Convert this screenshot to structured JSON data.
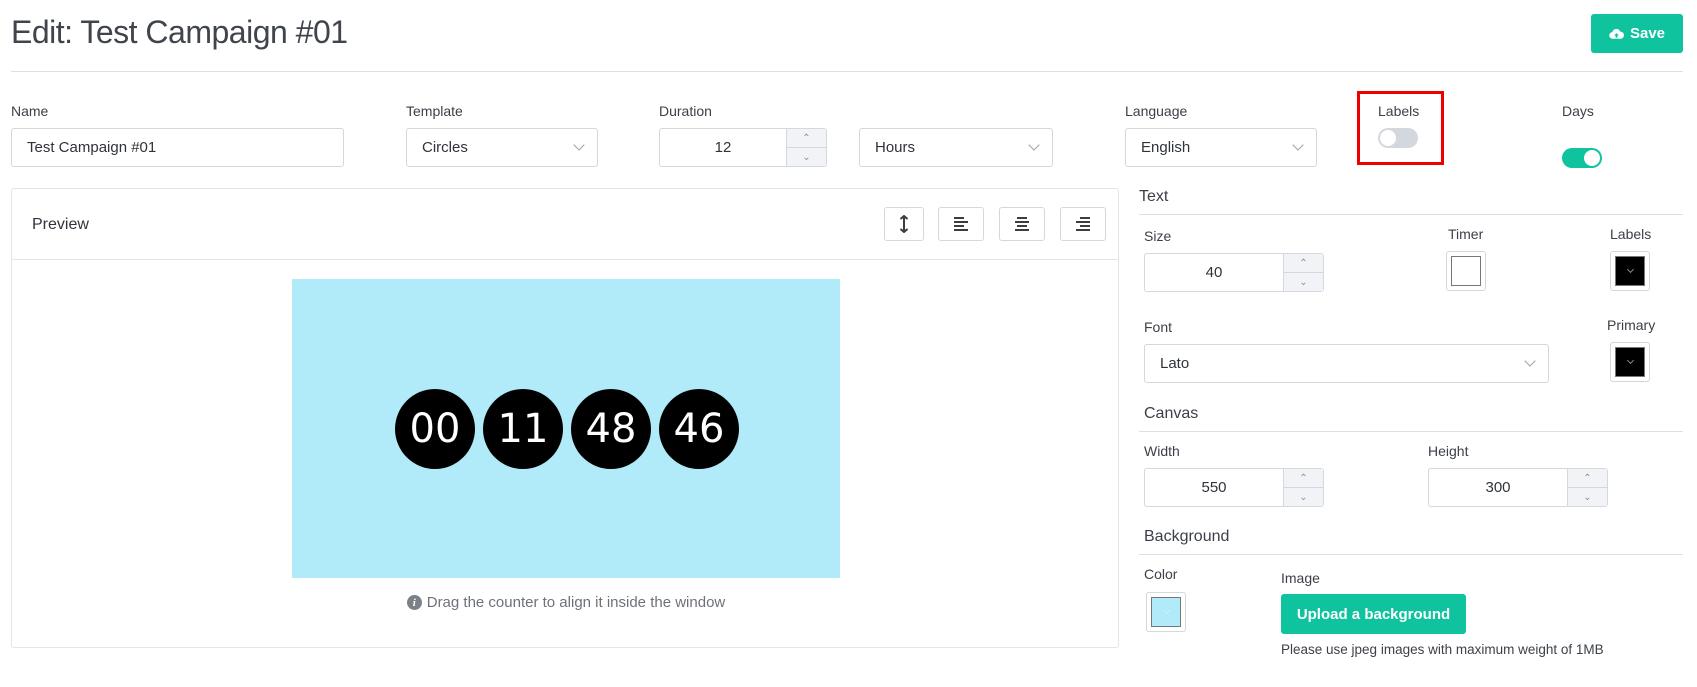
{
  "header": {
    "title": "Edit: Test Campaign #01",
    "save_label": "Save",
    "save_icon": "cloud-upload-icon"
  },
  "form": {
    "name": {
      "label": "Name",
      "value": "Test Campaign #01"
    },
    "template": {
      "label": "Template",
      "value": "Circles"
    },
    "duration": {
      "label": "Duration",
      "value": "12",
      "unit": "Hours"
    },
    "language": {
      "label": "Language",
      "value": "English"
    },
    "labels_toggle": {
      "label": "Labels",
      "on": false
    },
    "days_toggle": {
      "label": "Days",
      "on": true
    }
  },
  "preview": {
    "title": "Preview",
    "toolbar": [
      "vertical-align-icon",
      "align-left-icon",
      "align-center-icon",
      "align-right-icon"
    ],
    "counter": [
      "00",
      "11",
      "48",
      "46"
    ],
    "canvas_color": "#b1ebf9",
    "hint": "Drag the counter to align it inside the window"
  },
  "text_section": {
    "title": "Text",
    "size_label": "Size",
    "size_value": "40",
    "timer_label": "Timer",
    "timer_color": "#ffffff",
    "labels_label": "Labels",
    "labels_color": "#000000",
    "font_label": "Font",
    "font_value": "Lato",
    "primary_label": "Primary",
    "primary_color": "#000000"
  },
  "canvas_section": {
    "title": "Canvas",
    "width_label": "Width",
    "width_value": "550",
    "height_label": "Height",
    "height_value": "300"
  },
  "background_section": {
    "title": "Background",
    "color_label": "Color",
    "color_value": "#b1ebf9",
    "image_label": "Image",
    "upload_label": "Upload a background",
    "upload_hint": "Please use jpeg images with maximum weight of 1MB"
  },
  "colors": {
    "accent": "#0fc39f",
    "toggle_off": "#d3d7de",
    "highlight": "#ee0000"
  }
}
